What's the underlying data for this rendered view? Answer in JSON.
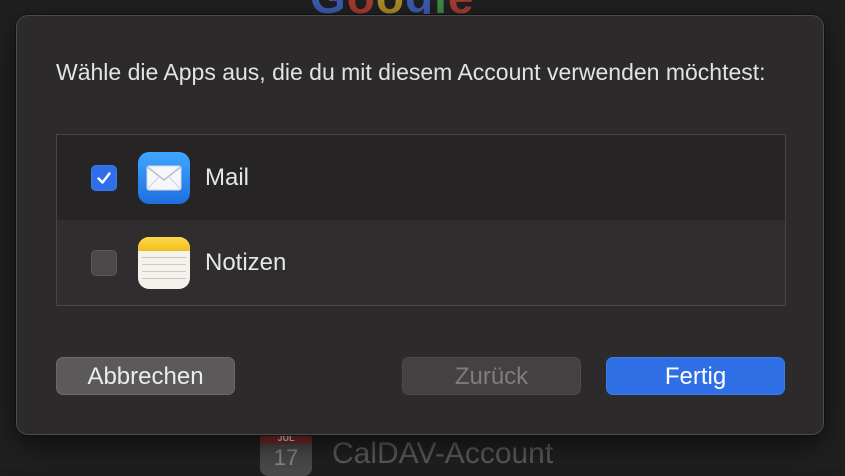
{
  "background": {
    "logo_letters": [
      "G",
      "o",
      "o",
      "g",
      "l",
      "e"
    ],
    "calendar_icon": {
      "month": "JUL",
      "day": "17"
    },
    "account_label": "CalDAV-Account"
  },
  "dialog": {
    "prompt": "Wähle die Apps aus, die du mit diesem Account verwenden möchtest:",
    "apps": [
      {
        "label": "Mail",
        "checked": true,
        "icon": "mail-app-icon"
      },
      {
        "label": "Notizen",
        "checked": false,
        "icon": "notes-app-icon"
      }
    ],
    "buttons": {
      "cancel": "Abbrechen",
      "back": "Zurück",
      "done": "Fertig"
    }
  },
  "colors": {
    "accent": "#2e6fe6",
    "dialog_bg": "#2c2a2a"
  }
}
